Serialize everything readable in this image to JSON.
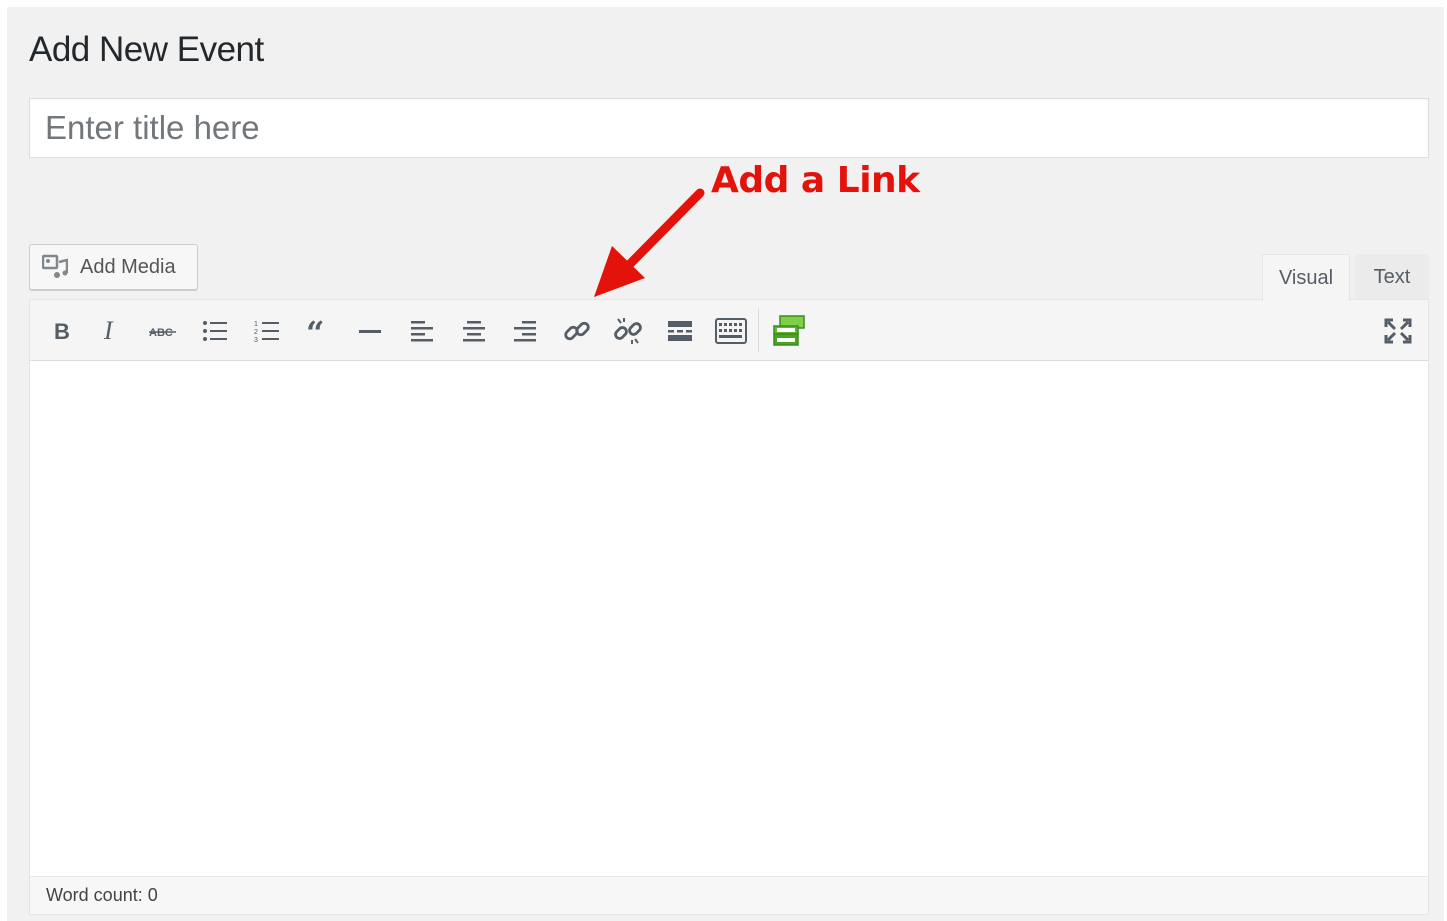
{
  "page": {
    "title": "Add New Event"
  },
  "title_field": {
    "placeholder": "Enter title here",
    "value": ""
  },
  "annotation": {
    "text": "Add a Link",
    "color": "#e3120b"
  },
  "media": {
    "add_media_label": "Add Media"
  },
  "editor_tabs": {
    "visual": "Visual",
    "text": "Text",
    "active": "Visual"
  },
  "toolbar": {
    "buttons": [
      "bold-icon",
      "italic-icon",
      "strikethrough-icon",
      "bulleted-list-icon",
      "numbered-list-icon",
      "blockquote-icon",
      "horizontal-line-icon",
      "align-left-icon",
      "align-center-icon",
      "align-right-icon",
      "insert-link-icon",
      "remove-link-icon",
      "read-more-icon",
      "toolbar-toggle-icon",
      "plugin-form-icon",
      "fullscreen-icon"
    ],
    "plugin_icon_color": "#5cb82d"
  },
  "status": {
    "word_count": "Word count: 0"
  }
}
